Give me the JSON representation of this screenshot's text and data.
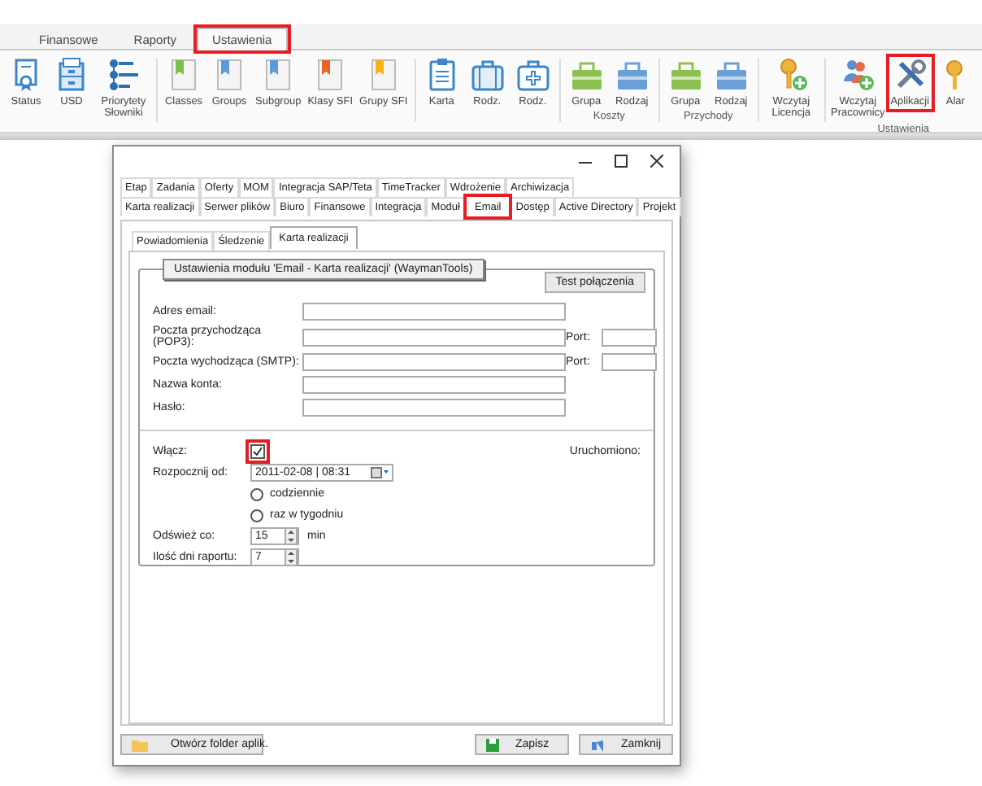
{
  "top_tabs": [
    {
      "label": "Finansowe",
      "selected": false,
      "highlighted": false
    },
    {
      "label": "Raporty",
      "selected": false,
      "highlighted": false
    },
    {
      "label": "Ustawienia",
      "selected": true,
      "highlighted": true
    }
  ],
  "ribbon": {
    "groups": [
      {
        "items": [
          {
            "label": "Status",
            "highlighted": false
          },
          {
            "label": "USD",
            "highlighted": false
          },
          {
            "label": "Priorytety Słowniki",
            "highlighted": false
          }
        ]
      },
      {
        "items": [
          {
            "label": "Classes",
            "highlighted": false
          },
          {
            "label": "Groups",
            "highlighted": false
          },
          {
            "label": "Subgroup",
            "highlighted": false
          },
          {
            "label": "Klasy SFI",
            "highlighted": false
          },
          {
            "label": "Grupy SFI",
            "highlighted": false
          }
        ]
      },
      {
        "items": [
          {
            "label": "Karta",
            "highlighted": false
          },
          {
            "label": "Rodz.",
            "highlighted": false
          },
          {
            "label": "Rodz.",
            "highlighted": false
          }
        ]
      },
      {
        "label": "Koszty",
        "items": [
          {
            "label": "Grupa",
            "highlighted": false
          },
          {
            "label": "Rodzaj",
            "highlighted": false
          }
        ]
      },
      {
        "label": "Przychody",
        "items": [
          {
            "label": "Grupa",
            "highlighted": false
          },
          {
            "label": "Rodzaj",
            "highlighted": false
          }
        ]
      },
      {
        "items": [
          {
            "label": "Wczytaj Licencja",
            "highlighted": false
          }
        ]
      },
      {
        "label": "Ustawienia",
        "items": [
          {
            "label": "Wczytaj Pracownicy",
            "highlighted": false
          },
          {
            "label": "Aplikacji",
            "highlighted": true
          },
          {
            "label": "Alar",
            "highlighted": false
          }
        ]
      }
    ]
  },
  "dialog": {
    "tab_rows": [
      [
        {
          "label": "Etap",
          "selected": false,
          "highlighted": false
        },
        {
          "label": "Zadania",
          "selected": false,
          "highlighted": false
        },
        {
          "label": "Oferty",
          "selected": false,
          "highlighted": false
        },
        {
          "label": "MOM",
          "selected": false,
          "highlighted": false
        },
        {
          "label": "Integracja SAP/Teta",
          "selected": false,
          "highlighted": false
        },
        {
          "label": "TimeTracker",
          "selected": false,
          "highlighted": false
        },
        {
          "label": "Wdrożenie",
          "selected": false,
          "highlighted": false
        },
        {
          "label": "Archiwizacja",
          "selected": false,
          "highlighted": false
        }
      ],
      [
        {
          "label": "Karta realizacji",
          "selected": false,
          "highlighted": false
        },
        {
          "label": "Serwer plików",
          "selected": false,
          "highlighted": false
        },
        {
          "label": "Biuro",
          "selected": false,
          "highlighted": false
        },
        {
          "label": "Finansowe",
          "selected": false,
          "highlighted": false
        },
        {
          "label": "Integracja",
          "selected": false,
          "highlighted": false
        },
        {
          "label": "Moduł",
          "selected": false,
          "highlighted": false
        },
        {
          "label": "Email",
          "selected": true,
          "highlighted": true
        },
        {
          "label": "Dostęp",
          "selected": false,
          "highlighted": false
        },
        {
          "label": "Active Directory",
          "selected": false,
          "highlighted": false
        },
        {
          "label": "Projekt",
          "selected": false,
          "highlighted": false
        }
      ]
    ],
    "subtabs": [
      {
        "label": "Powiadomienia",
        "selected": false
      },
      {
        "label": "Śledzenie",
        "selected": false
      },
      {
        "label": "Karta realizacji",
        "selected": true
      }
    ],
    "group_title": "Ustawienia modułu 'Email - Karta realizacji' (WaymanTools)",
    "test_button": "Test połączenia",
    "fields": [
      {
        "label": "Adres email:"
      },
      {
        "label": "Poczta przychodząca (POP3):",
        "port_label": "Port:"
      },
      {
        "label": "Poczta wychodząca (SMTP):",
        "port_label": "Port:"
      },
      {
        "label": "Nazwa konta:"
      },
      {
        "label": "Hasło:"
      }
    ],
    "enable": {
      "label": "Włącz:",
      "checked": true,
      "highlighted": true
    },
    "status_label": "Uruchomiono:",
    "start": {
      "label": "Rozpocznij od:",
      "value": "2011-02-08 | 08:31"
    },
    "frequency": [
      {
        "label": "codziennie",
        "selected": false
      },
      {
        "label": "raz w tygodniu",
        "selected": false
      }
    ],
    "refresh": {
      "label": "Odśwież co:",
      "value": "15",
      "unit": "min"
    },
    "report_days": {
      "label": "Ilość dni raportu:",
      "value": "7"
    },
    "footer": {
      "open_folder": "Otwórz folder aplik.",
      "save": "Zapisz",
      "close": "Zamknij"
    }
  }
}
